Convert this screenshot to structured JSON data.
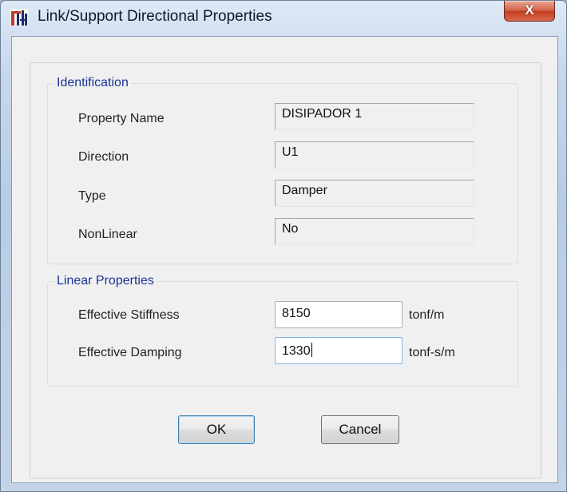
{
  "window": {
    "title": "Link/Support Directional Properties",
    "icon": "etabs-app-icon",
    "close_glyph": "X"
  },
  "identification": {
    "legend": "Identification",
    "fields": [
      {
        "label": "Property Name",
        "value": "DISIPADOR 1"
      },
      {
        "label": "Direction",
        "value": "U1"
      },
      {
        "label": "Type",
        "value": "Damper"
      },
      {
        "label": "NonLinear",
        "value": "No"
      }
    ]
  },
  "linear_properties": {
    "legend": "Linear Properties",
    "stiffness": {
      "label": "Effective Stiffness",
      "value": "8150",
      "unit": "tonf/m"
    },
    "damping": {
      "label": "Effective Damping",
      "value": "1330",
      "unit": "tonf-s/m"
    }
  },
  "buttons": {
    "ok": "OK",
    "cancel": "Cancel"
  }
}
